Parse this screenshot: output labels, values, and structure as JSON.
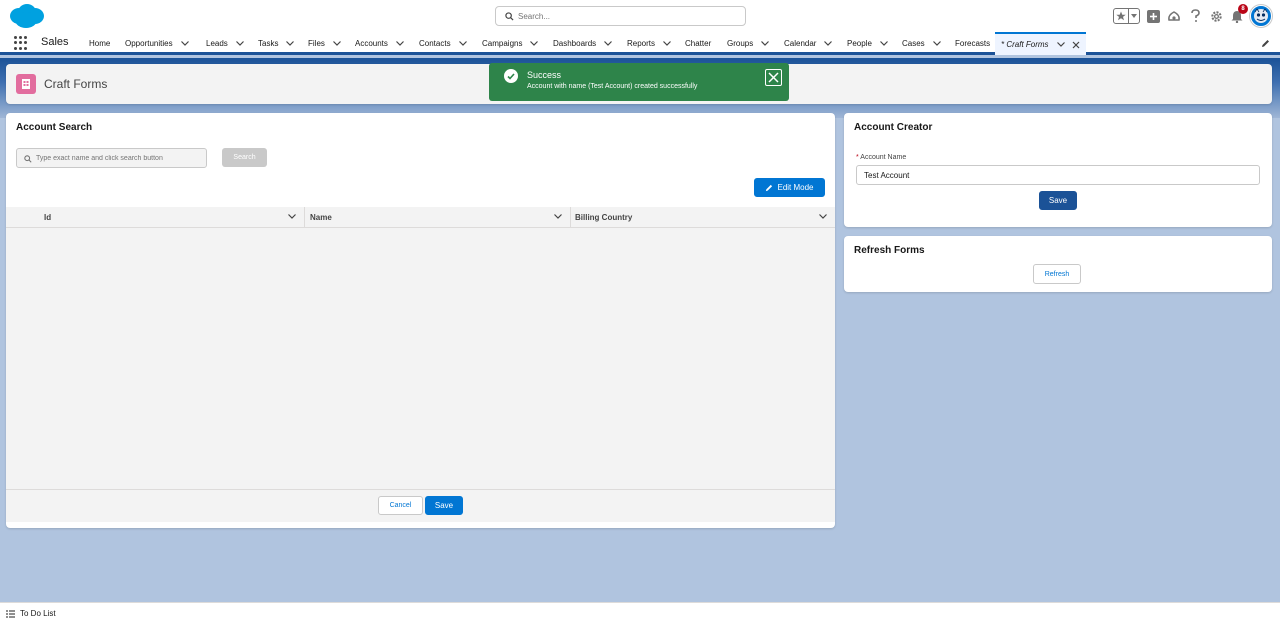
{
  "global_header": {
    "search_placeholder": "Search...",
    "notification_count": "8"
  },
  "app_nav": {
    "app_name": "Sales",
    "items": [
      {
        "label": "Home"
      },
      {
        "label": "Opportunities"
      },
      {
        "label": "Leads"
      },
      {
        "label": "Tasks"
      },
      {
        "label": "Files"
      },
      {
        "label": "Accounts"
      },
      {
        "label": "Contacts"
      },
      {
        "label": "Campaigns"
      },
      {
        "label": "Dashboards"
      },
      {
        "label": "Reports"
      },
      {
        "label": "Chatter"
      },
      {
        "label": "Groups"
      },
      {
        "label": "Calendar"
      },
      {
        "label": "People"
      },
      {
        "label": "Cases"
      },
      {
        "label": "Forecasts"
      },
      {
        "label": "* Craft Forms"
      }
    ]
  },
  "page_header": {
    "title": "Craft Forms"
  },
  "toast": {
    "title": "Success",
    "message": "Account with name (Test Account) created successfully"
  },
  "account_search": {
    "title": "Account Search",
    "input_placeholder": "Type exact name and click search button",
    "search_label": "Search",
    "edit_mode_label": "Edit Mode",
    "columns": [
      "Id",
      "Name",
      "Billing Country"
    ],
    "cancel_label": "Cancel",
    "save_label": "Save"
  },
  "account_creator": {
    "title": "Account Creator",
    "field_required_marker": "*",
    "field_label": "Account Name",
    "field_value": "Test Account",
    "save_label": "Save"
  },
  "refresh_forms": {
    "title": "Refresh Forms",
    "refresh_label": "Refresh"
  },
  "utility_bar": {
    "todo_label": "To Do List"
  },
  "colors": {
    "brand": "#0176d3",
    "success": "#2e844a",
    "nav_border": "#1b5297",
    "page_bg": "#b0c4df"
  }
}
